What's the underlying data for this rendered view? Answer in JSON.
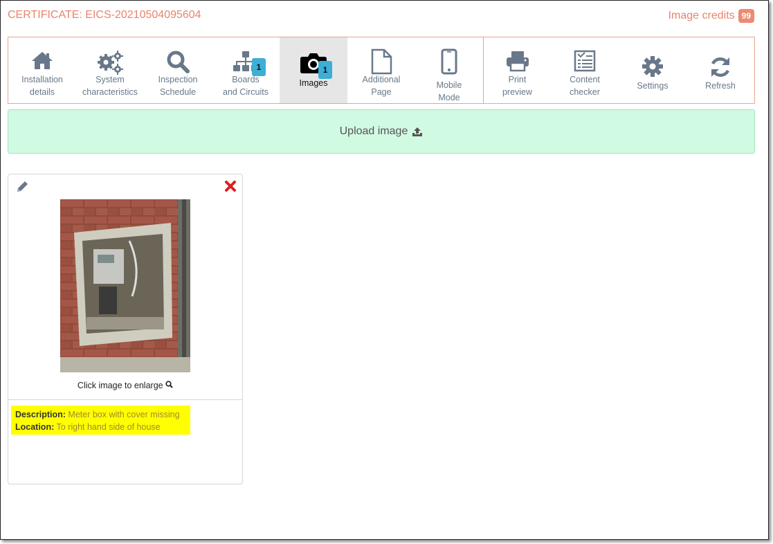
{
  "header": {
    "certificate": "CERTIFICATE: EICS-20210504095604",
    "credits_label": "Image credits",
    "credits_count": "99"
  },
  "toolbar": {
    "items": [
      {
        "line1": "Installation",
        "line2": "details",
        "icon": "house-icon"
      },
      {
        "line1": "System",
        "line2": "characteristics",
        "icon": "gears-icon"
      },
      {
        "line1": "Inspection",
        "line2": "Schedule",
        "icon": "search-icon"
      },
      {
        "line1": "Boards",
        "line2": "and Circuits",
        "icon": "sitemap-icon",
        "badge": "1"
      },
      {
        "line1": "Images",
        "line2": "",
        "icon": "camera-icon",
        "badge": "1",
        "active": true
      },
      {
        "line1": "Additional",
        "line2": "Page",
        "icon": "file-icon"
      },
      {
        "line1": "Mobile",
        "line2": "Mode",
        "icon": "mobile-icon"
      },
      {
        "line1": "Print",
        "line2": "preview",
        "icon": "print-icon"
      },
      {
        "line1": "Content",
        "line2": "checker",
        "icon": "checklist-icon"
      },
      {
        "line1": "Settings",
        "line2": "",
        "icon": "gear-icon"
      },
      {
        "line1": "Refresh",
        "line2": "",
        "icon": "refresh-icon"
      }
    ]
  },
  "upload": {
    "label": "Upload image"
  },
  "image_card": {
    "enlarge_text": "Click image to enlarge",
    "description_label": "Description:",
    "description_value": "Meter box with cover missing",
    "location_label": "Location:",
    "location_value": "To right hand side of house"
  },
  "colors": {
    "accent": "#e8846b",
    "badge": "#3eaed5",
    "upload_bg": "#d1fae3",
    "highlight": "#ffff00",
    "icon": "#68788a"
  }
}
